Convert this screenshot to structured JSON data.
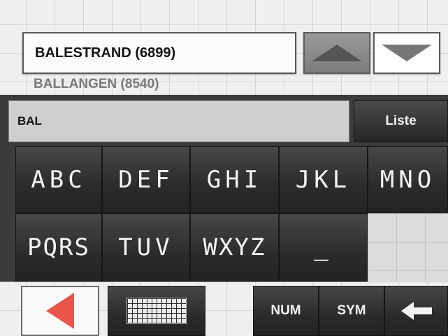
{
  "suggestions": {
    "current": "BALESTRAND (6899)",
    "next": "BALLANGEN (8540)"
  },
  "scroll": {
    "up_icon": "triangle-up-icon",
    "down_icon": "triangle-down-icon"
  },
  "input": {
    "value": "BAL"
  },
  "list_button": {
    "label": "Liste"
  },
  "keys": {
    "abc": "ABC",
    "def": "DEF",
    "ghi": "GHI",
    "jkl": "JKL",
    "mno": "MNO",
    "pqrs": "PQRS",
    "tuv": "TUV",
    "wxyz": "WXYZ",
    "space": "_"
  },
  "bottom": {
    "back_icon": "triangle-left-icon",
    "keyboard_icon": "keyboard-grid-icon",
    "num": "NUM",
    "sym": "SYM",
    "backspace_icon": "arrow-left-icon"
  },
  "colors": {
    "accent_red": "#e8554a",
    "key_dark": "#2b2b2b",
    "panel": "#3b3b3b"
  }
}
